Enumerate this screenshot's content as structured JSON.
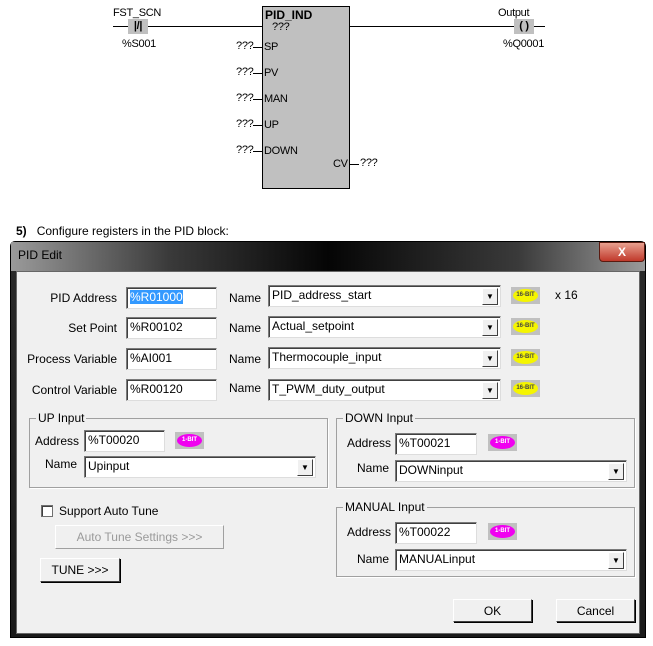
{
  "ladder": {
    "contact_label": "FST_SCN",
    "contact_symbol": "|/|",
    "contact_address": "%S001",
    "block_name": "PID_IND",
    "block_instance": "???",
    "inputs": [
      {
        "pin": "SP",
        "value": "???"
      },
      {
        "pin": "PV",
        "value": "???"
      },
      {
        "pin": "MAN",
        "value": "???"
      },
      {
        "pin": "UP",
        "value": "???"
      },
      {
        "pin": "DOWN",
        "value": "???"
      }
    ],
    "output_pin": "CV",
    "output_value": "???",
    "coil_label": "Output",
    "coil_symbol": "( )",
    "coil_address": "%Q0001"
  },
  "step": {
    "number": "5)",
    "text": "Configure registers in the PID block:"
  },
  "dialog": {
    "title": "PID Edit",
    "close_label": "X",
    "name_label": "Name",
    "rows": [
      {
        "label": "PID Address",
        "address": "%R01000",
        "name": "PID_address_start",
        "badge": "16-BIT",
        "suffix": "x 16"
      },
      {
        "label": "Set Point",
        "address": "%R00102",
        "name": "Actual_setpoint",
        "badge": "16-BIT"
      },
      {
        "label": "Process Variable",
        "address": "%AI001",
        "name": "Thermocouple_input",
        "badge": "16-BIT"
      },
      {
        "label": "Control Variable",
        "address": "%R00120",
        "name": "T_PWM_duty_output",
        "badge": "16-BIT"
      }
    ],
    "address_label": "Address",
    "up": {
      "title": "UP Input",
      "address": "%T00020",
      "name": "Upinput",
      "badge": "1-BIT"
    },
    "down": {
      "title": "DOWN Input",
      "address": "%T00021",
      "name": "DOWNinput",
      "badge": "1-BIT"
    },
    "manual": {
      "title": "MANUAL Input",
      "address": "%T00022",
      "name": "MANUALinput",
      "badge": "1-BIT"
    },
    "auto_tune_label": "Support Auto Tune",
    "auto_tune_checked": false,
    "auto_tune_settings": "Auto Tune Settings >>>",
    "tune": "TUNE >>>",
    "ok": "OK",
    "cancel": "Cancel"
  }
}
